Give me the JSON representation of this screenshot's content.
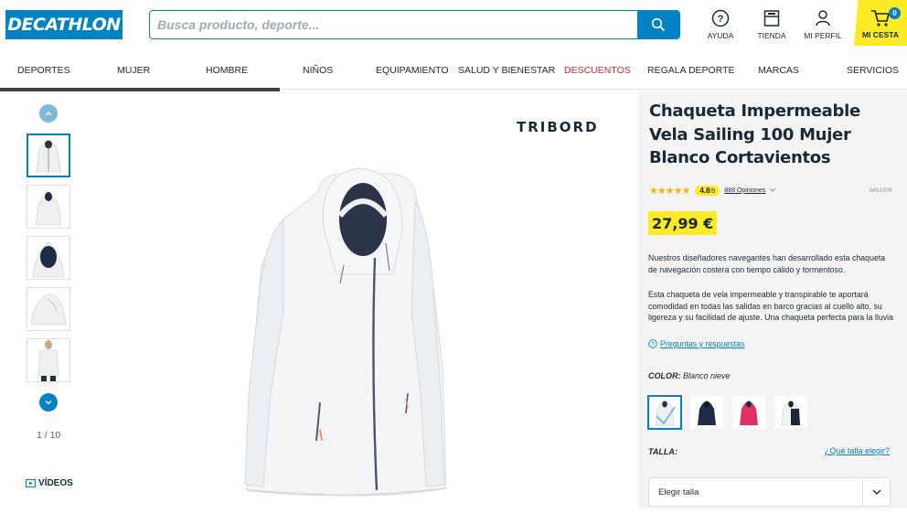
{
  "header": {
    "logo": "DECATHLON",
    "search_placeholder": "Busca producto, deporte...",
    "help_label": "AYUDA",
    "store_label": "TIENDA",
    "profile_label": "MI PERFIL",
    "cart_label": "MI CESTA",
    "cart_count": "0"
  },
  "nav": {
    "items": [
      "DEPORTES",
      "MUJER",
      "HOMBRE",
      "NIÑOS",
      "EQUIPAMIENTO",
      "SALUD Y BIENESTAR",
      "DESCUENTOS",
      "REGALA DEPORTE",
      "MARCAS",
      "SERVICIOS"
    ],
    "highlight_color": "#e3262f"
  },
  "gallery": {
    "counter": "1 / 10",
    "videos_label": "VÍDEOS",
    "brand": "TRIBORD"
  },
  "product": {
    "title": "Chaqueta Impermeable Vela Sailing 100 Mujer Blanco Cortavientos",
    "stars": "★★★★★",
    "rating": "4.8",
    "rating_max": "/5",
    "opinions": "888 Opiniones",
    "ref": "8491506",
    "price": "27,99 €",
    "desc1": "Nuestros diseñadores navegantes han desarrollado esta chaqueta de navegación costera con tiempo cálido y tormentoso.",
    "desc2": "Esta chaqueta de vela impermeable y transpirable te aportará comodidad en todas las salidas en barco gracias al cuello alto, su ligereza y su facilidad de ajuste. Una chaqueta perfecta para la lluvia",
    "qa_link": "Preguntas y respuestas",
    "color_label": "COLOR:",
    "color_value": "Blanco nieve",
    "size_label": "TALLA:",
    "size_help": "¿Qué talla elegir?",
    "size_select": "Elegir talla"
  },
  "colors": {
    "brand_blue": "#0082c3",
    "yellow": "#ffea28",
    "swatches": [
      "#f4f6f8",
      "#1f2a44",
      "#e0305f",
      "#1c2538"
    ]
  }
}
